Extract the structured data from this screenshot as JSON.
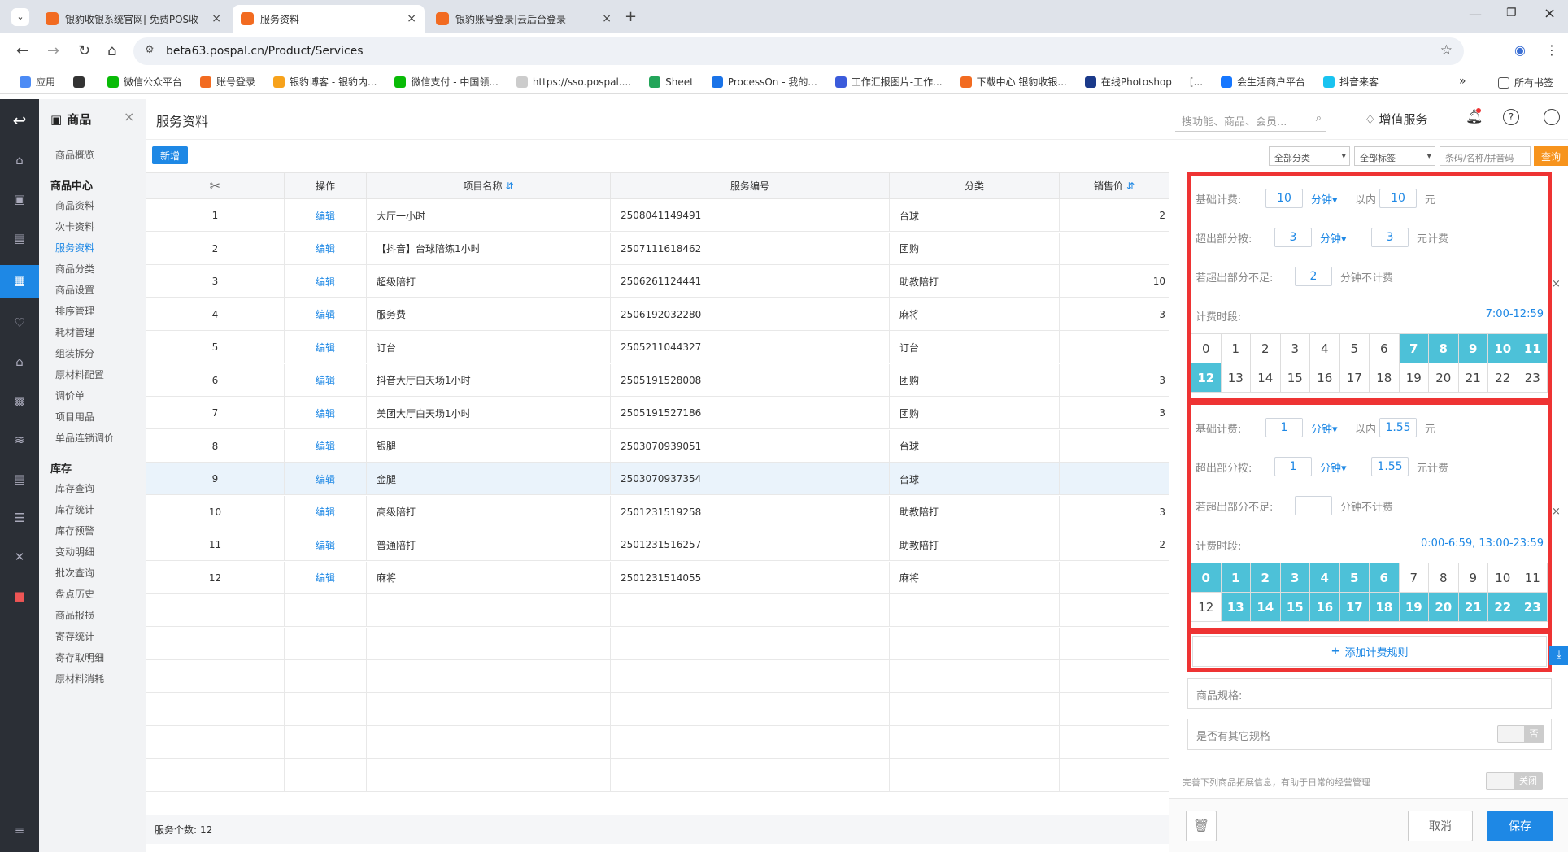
{
  "browser": {
    "tabs": [
      {
        "label": "银豹收银系统官网| 免费POS收"
      },
      {
        "label": "服务资料"
      },
      {
        "label": "银豹账号登录|云后台登录"
      }
    ],
    "url": "beta63.pospal.cn/Product/Services",
    "bookmarks": [
      "应用",
      "微信公众平台",
      "账号登录",
      "银豹博客 - 银豹内...",
      "微信支付 - 中国领...",
      "https://sso.pospal....",
      "Sheet",
      "ProcessOn - 我的...",
      "工作汇报图片-工作...",
      "下载中心 银豹收银...",
      "在线Photoshop",
      "[...",
      "会生活商户平台",
      "抖音来客"
    ],
    "all_bookmarks": "所有书签"
  },
  "sidebar": {
    "header": "商品",
    "groups": [
      {
        "title": "",
        "items": [
          "商品概览"
        ]
      },
      {
        "title": "商品中心",
        "items": [
          "商品资料",
          "次卡资料",
          "服务资料",
          "商品分类",
          "商品设置",
          "排序管理",
          "耗材管理",
          "组装拆分",
          "原材料配置",
          "调价单",
          "项目用品",
          "单品连锁调价"
        ]
      },
      {
        "title": "库存",
        "items": [
          "库存查询",
          "库存统计",
          "库存预警",
          "变动明细",
          "批次查询",
          "盘点历史",
          "商品报损",
          "寄存统计",
          "寄存取明细",
          "原材料消耗"
        ]
      }
    ],
    "active": "服务资料"
  },
  "header": {
    "title": "服务资料",
    "search_placeholder": "搜功能、商品、会员...",
    "vas": "增值服务"
  },
  "toolbar": {
    "new": "新增",
    "category": "全部分类",
    "tag": "全部标签",
    "search_placeholder": "条码/名称/拼音码",
    "query": "查询"
  },
  "table": {
    "columns": [
      "",
      "操作",
      "项目名称",
      "服务编号",
      "分类",
      "销售价"
    ],
    "edit_label": "编辑",
    "rows": [
      {
        "no": "1",
        "name": "大厅一小时",
        "code": "2508041149491",
        "cat": "台球",
        "price": "2"
      },
      {
        "no": "2",
        "name": "【抖音】台球陪练1小时",
        "code": "2507111618462",
        "cat": "团购",
        "price": ""
      },
      {
        "no": "3",
        "name": "超级陪打",
        "code": "2506261124441",
        "cat": "助教陪打",
        "price": "10"
      },
      {
        "no": "4",
        "name": "服务费",
        "code": "2506192032280",
        "cat": "麻将",
        "price": "3"
      },
      {
        "no": "5",
        "name": "订台",
        "code": "2505211044327",
        "cat": "订台",
        "price": ""
      },
      {
        "no": "6",
        "name": "抖音大厅白天场1小时",
        "code": "2505191528008",
        "cat": "团购",
        "price": "3"
      },
      {
        "no": "7",
        "name": "美团大厅白天场1小时",
        "code": "2505191527186",
        "cat": "团购",
        "price": "3"
      },
      {
        "no": "8",
        "name": "银腿",
        "code": "2503070939051",
        "cat": "台球",
        "price": ""
      },
      {
        "no": "9",
        "name": "金腿",
        "code": "2503070937354",
        "cat": "台球",
        "price": ""
      },
      {
        "no": "10",
        "name": "高级陪打",
        "code": "2501231519258",
        "cat": "助教陪打",
        "price": "3"
      },
      {
        "no": "11",
        "name": "普通陪打",
        "code": "2501231516257",
        "cat": "助教陪打",
        "price": "2"
      },
      {
        "no": "12",
        "name": "麻将",
        "code": "2501231514055",
        "cat": "麻将",
        "price": ""
      }
    ],
    "footer_label": "服务个数:",
    "footer_count": "12"
  },
  "rule1": {
    "base_label": "基础计费:",
    "base_val": "10",
    "unit": "分钟",
    "within": "以内",
    "base_price": "10",
    "yuan": "元",
    "over_label": "超出部分按:",
    "over_val": "3",
    "over_price": "3",
    "yuan_fee": "元计费",
    "insuff_label": "若超出部分不足:",
    "insuff_val": "2",
    "no_charge": "分钟不计费",
    "period_label": "计费时段:",
    "period_val": "7:00-12:59",
    "hours_on": [
      7,
      8,
      9,
      10,
      11,
      12
    ]
  },
  "rule2": {
    "base_label": "基础计费:",
    "base_val": "1",
    "unit": "分钟",
    "within": "以内",
    "base_price": "1.55",
    "yuan": "元",
    "over_label": "超出部分按:",
    "over_val": "1",
    "over_price": "1.55",
    "yuan_fee": "元计费",
    "insuff_label": "若超出部分不足:",
    "insuff_val": "",
    "no_charge": "分钟不计费",
    "period_label": "计费时段:",
    "period_val": "0:00-6:59, 13:00-23:59",
    "hours_on": [
      0,
      1,
      2,
      3,
      4,
      5,
      6,
      13,
      14,
      15,
      16,
      17,
      18,
      19,
      20,
      21,
      22,
      23
    ]
  },
  "panel": {
    "add_rule": "添加计费规则",
    "spec_label": "商品规格:",
    "other_spec": "是否有其它规格",
    "other_toggle": "否",
    "extend_hint": "完善下列商品拓展信息，有助于日常的经营管理",
    "extend_toggle": "关闭",
    "cancel": "取消",
    "save": "保存"
  },
  "colors": {
    "accent": "#1e88e5",
    "hour_on": "#4dc1d8",
    "highlight": "#e33",
    "orange": "#f7941d"
  }
}
